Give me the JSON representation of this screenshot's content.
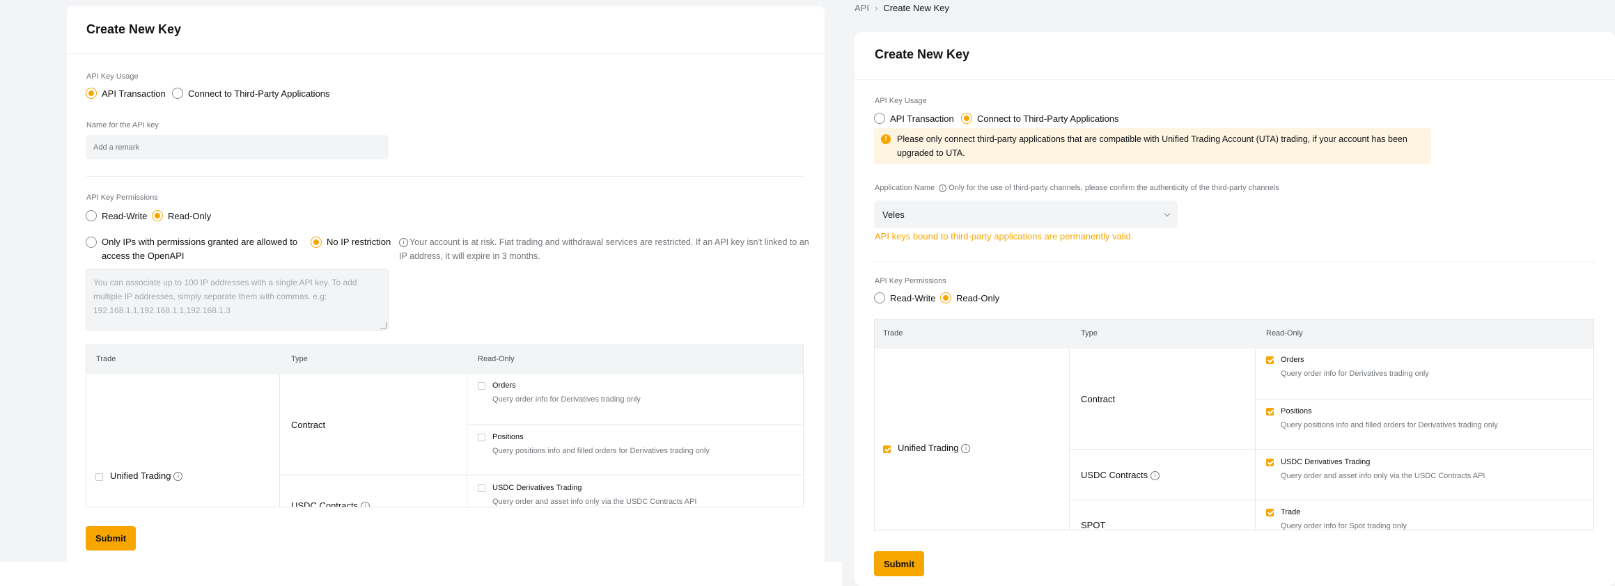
{
  "left": {
    "title": "Create New Key",
    "usage_label": "API Key Usage",
    "usage_options": [
      "API Transaction",
      "Connect to Third-Party Applications"
    ],
    "name_label": "Name for the API key",
    "name_placeholder": "Add a remark",
    "permissions_label": "API Key Permissions",
    "perm_options": [
      "Read-Write",
      "Read-Only"
    ],
    "ip_option_restricted": "Only IPs with permissions granted are allowed to access the OpenAPI",
    "ip_option_none": "No IP restriction",
    "ip_warning": "Your account is at risk. Fiat trading and withdrawal services are restricted. If an API key isn't linked to an IP address, it will expire in 3 months.",
    "ip_placeholder": "You can associate up to 100 IP addresses with a single API key. To add multiple IP addresses, simply separate them with commas. e.g: 192.168.1.1,192.168.1.1,192.168.1.3",
    "table": {
      "headers": [
        "Trade",
        "Type",
        "Read-Only"
      ],
      "trade": "Unified Trading",
      "types": [
        "Contract",
        "USDC Contracts"
      ],
      "perms": [
        {
          "title": "Orders",
          "desc": "Query order info for Derivatives trading only"
        },
        {
          "title": "Positions",
          "desc": "Query positions info and filled orders for Derivatives trading only"
        },
        {
          "title": "USDC Derivatives Trading",
          "desc": "Query order and asset info only via the USDC Contracts API"
        }
      ]
    },
    "submit": "Submit"
  },
  "right": {
    "breadcrumb": [
      "API",
      "Create New Key"
    ],
    "title": "Create New Key",
    "usage_label": "API Key Usage",
    "usage_options": [
      "API Transaction",
      "Connect to Third-Party Applications"
    ],
    "notice": "Please only connect third-party applications that are compatible with Unified Trading Account (UTA) trading, if your account has been upgraded to UTA.",
    "app_name_label": "Application Name",
    "app_name_hint": "Only for the use of third-party channels, please confirm the authenticity of the third-party channels",
    "app_name_value": "Veles",
    "valid_note": "API keys bound to third-party applications are permanently valid.",
    "permissions_label": "API Key Permissions",
    "perm_options": [
      "Read-Write",
      "Read-Only"
    ],
    "table": {
      "headers": [
        "Trade",
        "Type",
        "Read-Only"
      ],
      "trade": "Unified Trading",
      "types": [
        "Contract",
        "USDC Contracts",
        "SPOT"
      ],
      "perms": [
        {
          "title": "Orders",
          "desc": "Query order info for Derivatives trading only"
        },
        {
          "title": "Positions",
          "desc": "Query positions info and filled orders for Derivatives trading only"
        },
        {
          "title": "USDC Derivatives Trading",
          "desc": "Query order and asset info only via the USDC Contracts API"
        },
        {
          "title": "Trade",
          "desc": "Query order info for Spot trading only"
        }
      ]
    },
    "submit": "Submit"
  },
  "colors": {
    "accent": "#f7a600",
    "background": "#f3f4f6",
    "notice_bg": "#fdf4e1"
  }
}
